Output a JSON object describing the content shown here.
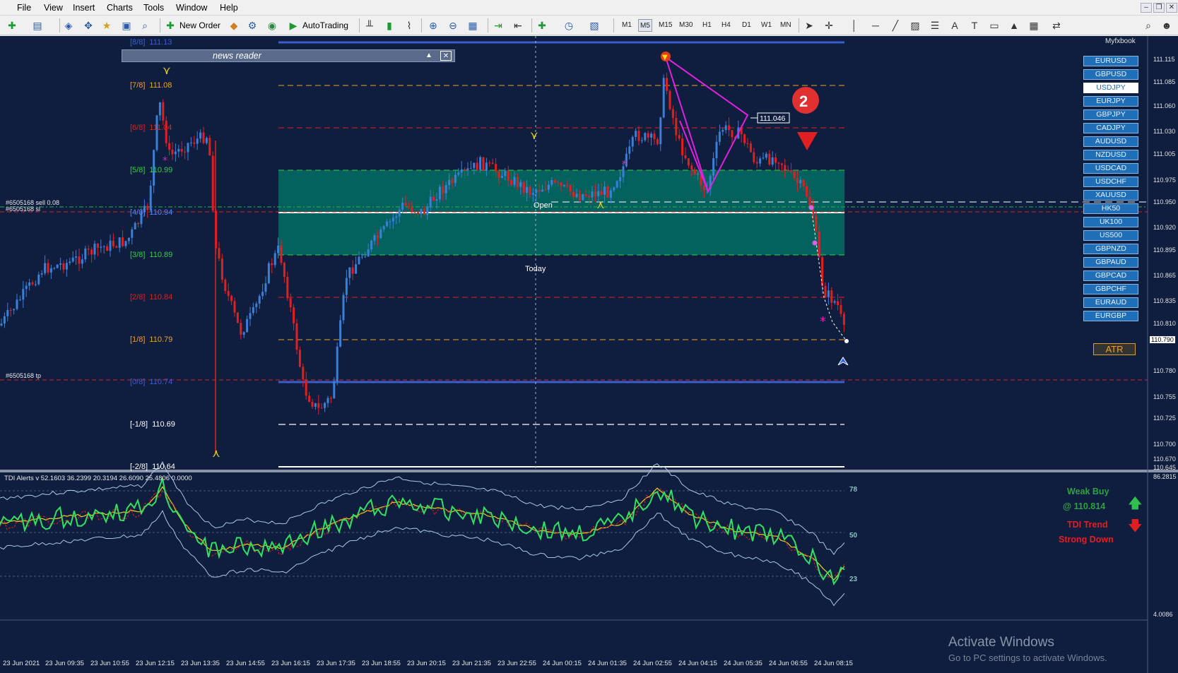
{
  "menu": [
    "File",
    "View",
    "Insert",
    "Charts",
    "Tools",
    "Window",
    "Help"
  ],
  "toolbar": {
    "new_order": "New Order",
    "autotrading": "AutoTrading",
    "timeframes": [
      "M1",
      "M5",
      "M15",
      "M30",
      "H1",
      "H4",
      "D1",
      "W1",
      "MN"
    ],
    "active_timeframe": "M5"
  },
  "chart": {
    "broker_label": "Myfxbook",
    "news_reader_title": "news reader",
    "price_box_value": "111.046",
    "badge_number": "2",
    "open_label": "Open",
    "today_label": "Today",
    "order_labels": {
      "sell": "#6505168 sell 0.08",
      "sl": "#6505168 sl",
      "tp": "#6505168 tp"
    },
    "murrey_levels": [
      {
        "label": "[8/8]",
        "value": "111.13",
        "color": "#3a5fcd"
      },
      {
        "label": "[7/8]",
        "value": "111.08",
        "color": "#f0a020"
      },
      {
        "label": "[6/8]",
        "value": "111.04",
        "color": "#e02020"
      },
      {
        "label": "[5/8]",
        "value": "110.99",
        "color": "#30d040"
      },
      {
        "label": "[4/8]",
        "value": "110.94",
        "color": "#4a8aff"
      },
      {
        "label": "[3/8]",
        "value": "110.89",
        "color": "#30d040"
      },
      {
        "label": "[2/8]",
        "value": "110.84",
        "color": "#e02020"
      },
      {
        "label": "[1/8]",
        "value": "110.79",
        "color": "#f0a020"
      },
      {
        "label": "[0/8]",
        "value": "110.74",
        "color": "#3a5fcd"
      },
      {
        "label": "[-1/8]",
        "value": "110.69",
        "color": "#ffffff"
      },
      {
        "label": "[-2/8]",
        "value": "110.64",
        "color": "#ffffff"
      }
    ],
    "price_axis": [
      "111.115",
      "111.085",
      "111.060",
      "111.030",
      "111.005",
      "110.975",
      "110.950",
      "110.920",
      "110.895",
      "110.865",
      "110.835",
      "110.810",
      "110.790",
      "110.780",
      "110.755",
      "110.725",
      "110.700",
      "110.670",
      "110.645"
    ],
    "current_price": "110.790",
    "time_axis": [
      "23 Jun 2021",
      "23 Jun 09:35",
      "23 Jun 10:55",
      "23 Jun 12:15",
      "23 Jun 13:35",
      "23 Jun 14:55",
      "23 Jun 16:15",
      "23 Jun 17:35",
      "23 Jun 18:55",
      "23 Jun 20:15",
      "23 Jun 21:35",
      "23 Jun 22:55",
      "24 Jun 00:15",
      "24 Jun 01:35",
      "24 Jun 02:55",
      "24 Jun 04:15",
      "24 Jun 05:35",
      "24 Jun 06:55",
      "24 Jun 08:15"
    ]
  },
  "symbols": [
    "EURUSD",
    "GBPUSD",
    "USDJPY",
    "EURJPY",
    "GBPJPY",
    "CADJPY",
    "AUDUSD",
    "NZDUSD",
    "USDCAD",
    "USDCHF",
    "XAUUSD",
    "HK50",
    "UK100",
    "US500",
    "GBPNZD",
    "GBPAUD",
    "GBPCAD",
    "GBPCHF",
    "EURAUD",
    "EURGBP"
  ],
  "active_symbol": "USDJPY",
  "atr_label": "ATR",
  "indicator": {
    "title": "TDI Alerts v 52.1603 36.2399 20.3194 26.6090 25.4806 0.0000",
    "levels": [
      "78",
      "50",
      "23"
    ],
    "axis_top": "86.2815",
    "axis_bottom": "4.0086",
    "signal_line1": "Weak Buy",
    "signal_line2": "@ 110.814",
    "trend_line1": "TDI Trend",
    "trend_line2": "Strong Down"
  },
  "watermark": {
    "title": "Activate Windows",
    "subtitle": "Go to PC settings to activate Windows."
  }
}
